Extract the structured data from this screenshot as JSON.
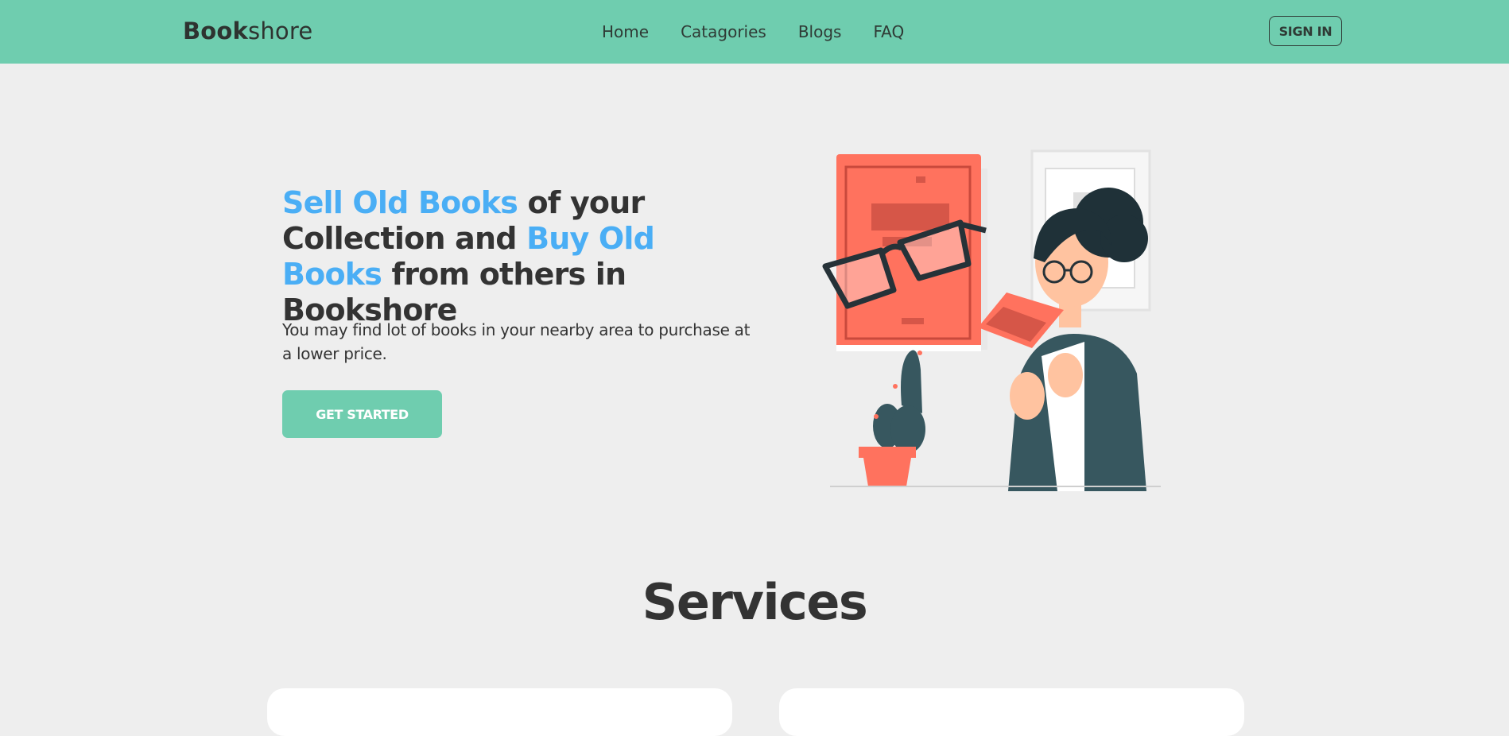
{
  "header": {
    "brand_bold": "Book",
    "brand_rest": "shore",
    "nav": [
      "Home",
      "Catagories",
      "Blogs",
      "FAQ"
    ],
    "signin_label": "SIGN IN"
  },
  "hero": {
    "title_hl1": "Sell Old Books",
    "title_part2": " of your Collection and ",
    "title_hl2": "Buy Old Books",
    "title_part3": " from others in Bookshore",
    "subtitle": "You may find lot of books in your nearby area to purchase at a lower price.",
    "cta_label": "GET STARTED"
  },
  "services": {
    "title": "Services"
  },
  "colors": {
    "brand": "#6fcdaf",
    "highlight": "#4aaef5",
    "text": "#333333",
    "background": "#eeeeee",
    "book": "#ff725e",
    "jacket": "#37575f"
  },
  "icons": [
    "reading-woman-illustration",
    "glasses-icon",
    "cactus-icon",
    "book-icon"
  ]
}
